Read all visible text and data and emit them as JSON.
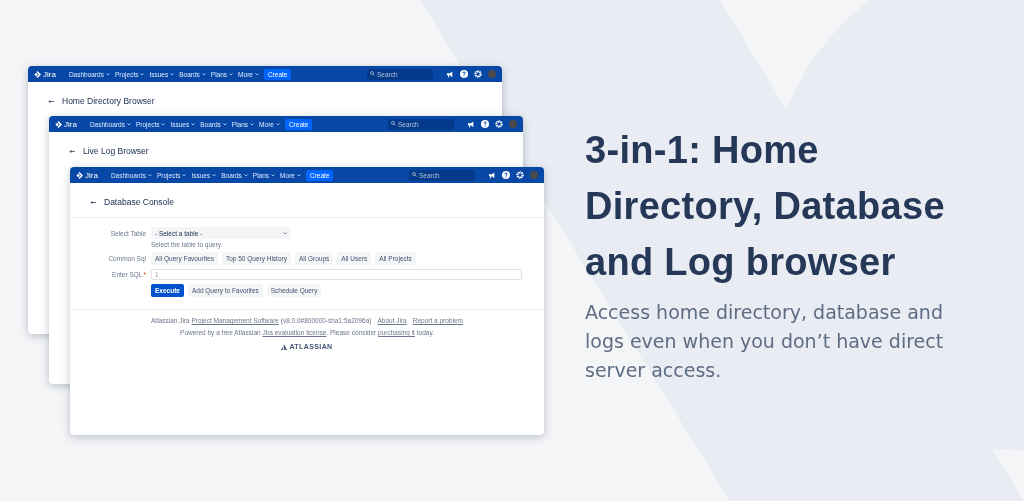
{
  "windows": [
    {
      "kind": "blank",
      "nav": {
        "logo": "Jira",
        "menu": [
          "Dashboards",
          "Projects",
          "Issues",
          "Boards",
          "Plans",
          "More"
        ],
        "create": "Create",
        "search_placeholder": "Search"
      },
      "title": "Home Directory Browser"
    },
    {
      "kind": "blank",
      "nav": {
        "logo": "Jira",
        "menu": [
          "Dashboards",
          "Projects",
          "Issues",
          "Boards",
          "Plans",
          "More"
        ],
        "create": "Create",
        "search_placeholder": "Search"
      },
      "title": "Live Log Browser"
    },
    {
      "kind": "console",
      "nav": {
        "logo": "Jira",
        "menu": [
          "Dashboards",
          "Projects",
          "Issues",
          "Boards",
          "Plans",
          "More"
        ],
        "create": "Create",
        "search_placeholder": "Search"
      },
      "title": "Database Console",
      "form": {
        "select_label": "Select Table",
        "select_value": "- Select a table -",
        "select_hint": "Select the table to query.",
        "common_label": "Common Sql",
        "common_buttons": [
          "All Query Favourites",
          "Top 50 Query History",
          "All Groups",
          "All Users",
          "All Projects"
        ],
        "sql_label": "Enter SQL",
        "required_mark": "*",
        "line_number": "1",
        "primary_button": "Execute",
        "buttons": [
          "Add Query to Favorites",
          "Schedule Query"
        ]
      },
      "footer": {
        "lines": [
          {
            "parts": [
              {
                "kind": "text",
                "text": "Atlassian Jira "
              },
              {
                "kind": "link",
                "text": "Project Management Software"
              },
              {
                "kind": "text",
                "text": " (v8.0.0#800000-sha1:5a2096a)"
              }
            ],
            "links": [
              "About Jira",
              "Report a problem"
            ]
          },
          {
            "parts": [
              {
                "kind": "text",
                "text": "Powered by a free Atlassian "
              },
              {
                "kind": "link",
                "text": "Jira evaluation license"
              },
              {
                "kind": "text",
                "text": ". Please consider "
              },
              {
                "kind": "link",
                "text": "purchasing it"
              },
              {
                "kind": "text",
                "text": " today."
              }
            ]
          }
        ],
        "brand": "ATLASSIAN"
      }
    }
  ],
  "headline": "3-in-1: Home Directory, Database and Log browser",
  "description": "Access home directory, database and logs even when you don’t have direct server access."
}
